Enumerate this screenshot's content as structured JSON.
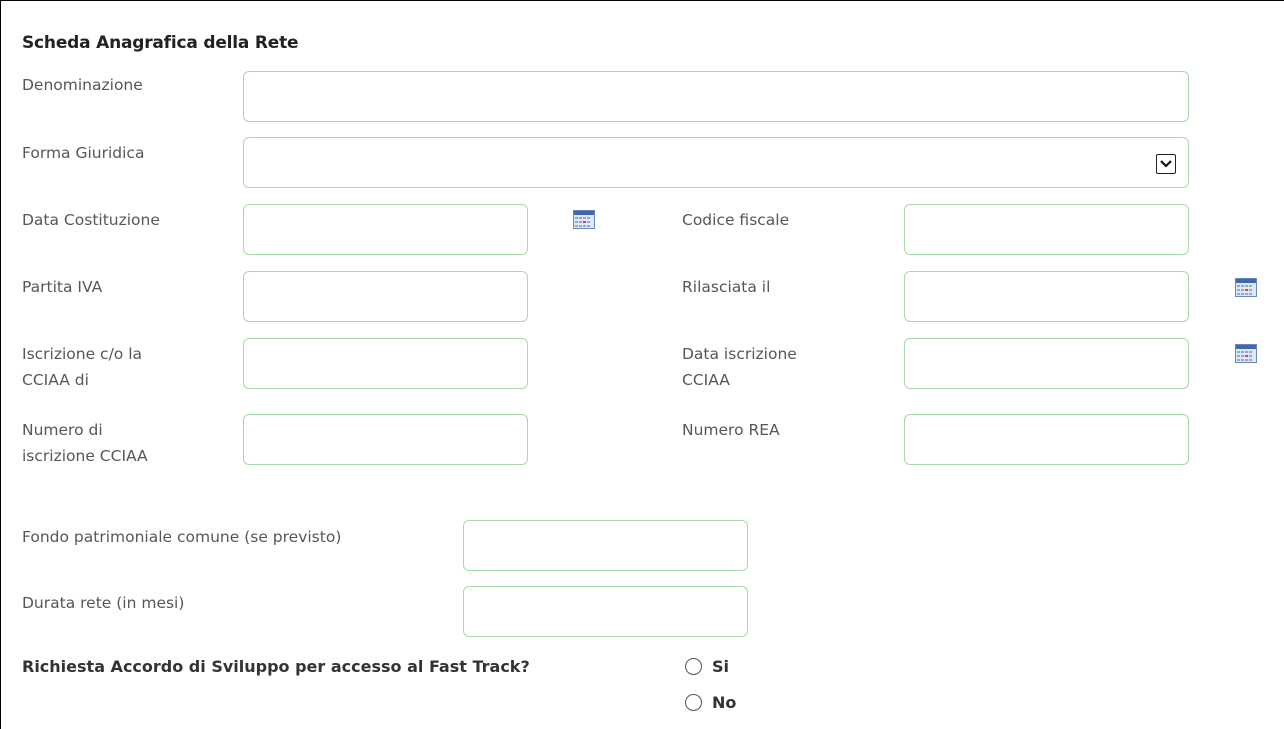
{
  "section_title": "Scheda Anagrafica della Rete",
  "fields": {
    "denominazione": {
      "label": "Denominazione",
      "value": ""
    },
    "forma_giuridica": {
      "label": "Forma Giuridica",
      "value": ""
    },
    "data_costituzione": {
      "label": "Data Costituzione",
      "value": ""
    },
    "codice_fiscale": {
      "label": "Codice fiscale",
      "value": ""
    },
    "partita_iva": {
      "label": "Partita IVA",
      "value": ""
    },
    "rilasciata_il": {
      "label": "Rilasciata il",
      "value": ""
    },
    "iscrizione_cciaa": {
      "label_line1": "Iscrizione c/o la",
      "label_line2": "CCIAA di",
      "value": ""
    },
    "data_iscrizione_cciaa": {
      "label_line1": "Data iscrizione",
      "label_line2": "CCIAA",
      "value": ""
    },
    "numero_iscrizione_cciaa": {
      "label_line1": "Numero di",
      "label_line2": "iscrizione CCIAA",
      "value": ""
    },
    "numero_rea": {
      "label": "Numero REA",
      "value": ""
    },
    "fondo_patrimoniale": {
      "label": "Fondo patrimoniale comune (se previsto)",
      "value": ""
    },
    "durata_rete": {
      "label": "Durata rete (in mesi)",
      "value": ""
    }
  },
  "fast_track": {
    "question": "Richiesta Accordo di Sviluppo per accesso al Fast Track?",
    "options": [
      "Si",
      "No"
    ]
  },
  "icons": {
    "calendar": "calendar-icon",
    "dropdown": "chevron-down-icon"
  },
  "colors": {
    "field_border": "#a8d9a8",
    "label_text": "#575757",
    "title_text": "#222222"
  }
}
